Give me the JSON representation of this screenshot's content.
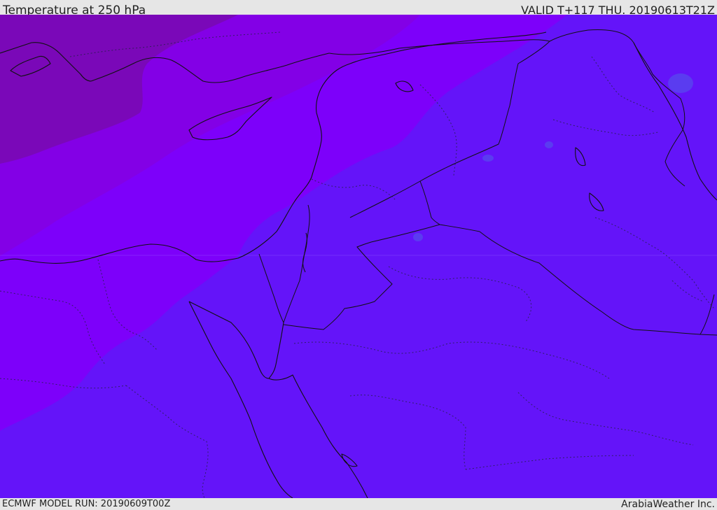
{
  "header": {
    "title": "Temperature at 250 hPa",
    "valid": "VALID T+117 THU. 20190613T21Z"
  },
  "footer": {
    "model_run": "ECMWF MODEL RUN: 20190609T00Z",
    "credit": "ArabiaWeather Inc."
  },
  "map": {
    "colors": {
      "band_warmest": "#6414f9",
      "band_mid": "#7d00fa",
      "band_cool": "#8300e6",
      "band_coldest": "#7a08b8",
      "spot": "#5a3cf0",
      "outline": "#111111"
    }
  }
}
